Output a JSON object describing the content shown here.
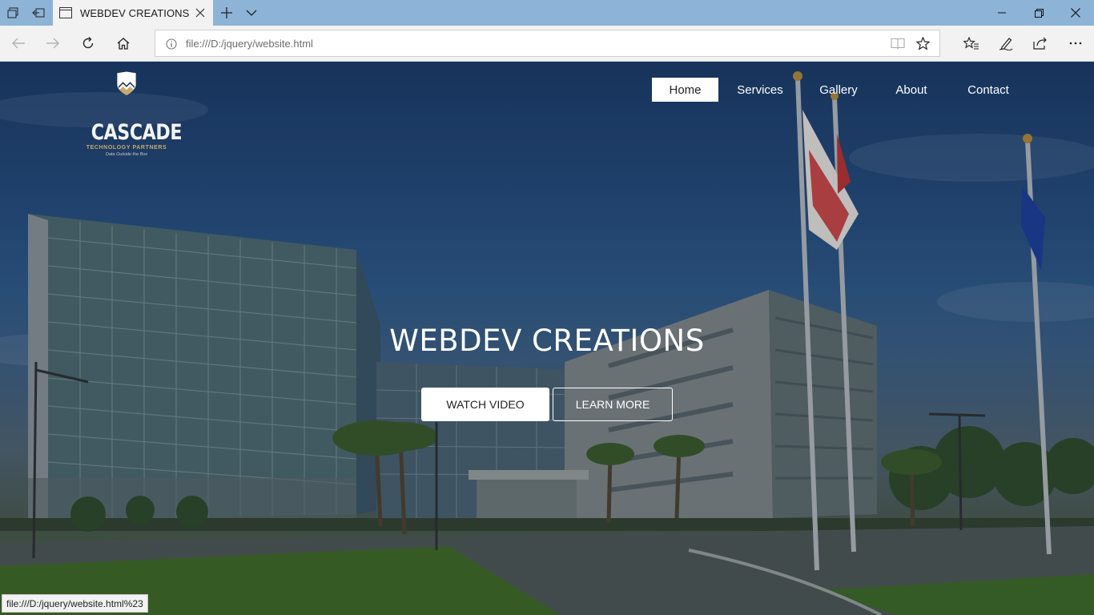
{
  "browser": {
    "tab_title": "WEBDEV CREATIONS",
    "url": "file:///D:/jquery/website.html",
    "status_url": "file:///D:/jquery/website.html%23"
  },
  "site": {
    "logo": {
      "name": "CASCADE",
      "subtitle": "TECHNOLOGY PARTNERS",
      "tagline": "Data Outside the Box"
    },
    "menu": [
      {
        "label": "Home",
        "active": true
      },
      {
        "label": "Services",
        "active": false
      },
      {
        "label": "Gallery",
        "active": false
      },
      {
        "label": "About",
        "active": false
      },
      {
        "label": "Contact",
        "active": false
      }
    ],
    "hero": {
      "title": "WEBDEV CREATIONS",
      "primary_button": "WATCH VIDEO",
      "secondary_button": "LEARN MORE"
    }
  },
  "colors": {
    "tabbar": "#8db3d7",
    "toolbar": "#f2f2f2",
    "logo_gold": "#c7a972"
  }
}
